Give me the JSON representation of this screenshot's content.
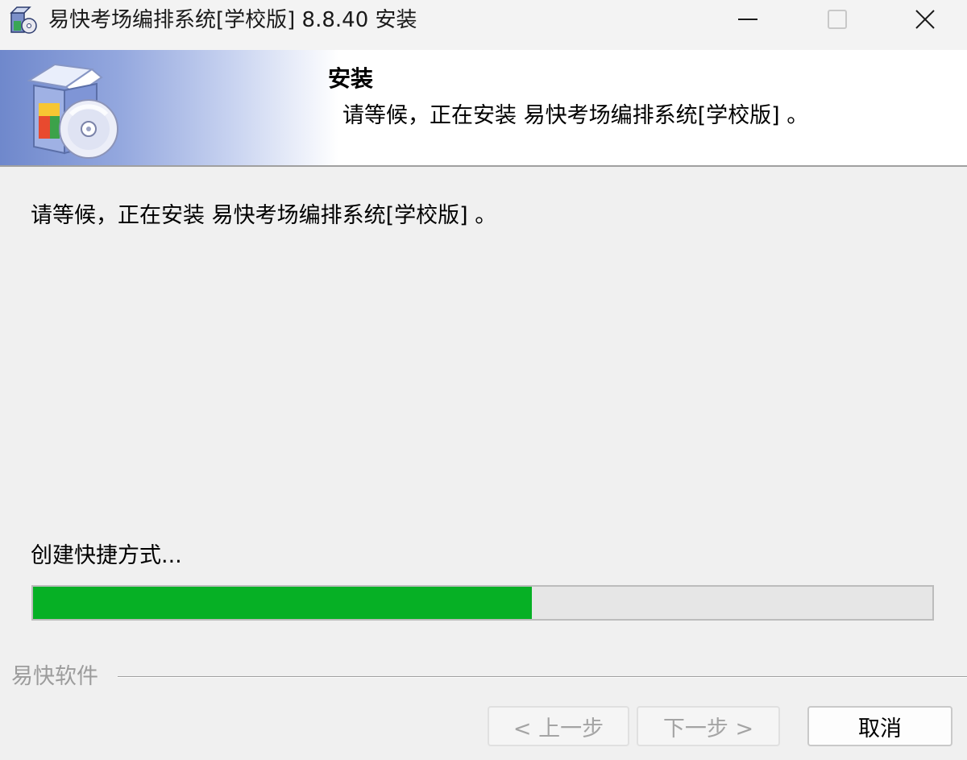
{
  "window": {
    "title": "易快考场编排系统[学校版] 8.8.40 安装",
    "icons": {
      "app": "installer-app-icon",
      "minimize": "minimize-icon",
      "maximize": "maximize-icon",
      "close": "close-icon"
    }
  },
  "banner": {
    "title": "安装",
    "subtitle": "请等候，正在安装 易快考场编排系统[学校版] 。",
    "art_icon": "software-box-with-cd-icon",
    "gradient_color": "#6f88cc"
  },
  "body": {
    "wait_message": "请等候，正在安装 易快考场编排系统[学校版] 。",
    "status": "创建快捷方式...",
    "progress_percent": 55.5,
    "progress_color": "#06b025"
  },
  "footer": {
    "brand": "易快软件",
    "buttons": {
      "back": "< 上一步",
      "next": "下一步 >",
      "cancel": "取消"
    }
  }
}
